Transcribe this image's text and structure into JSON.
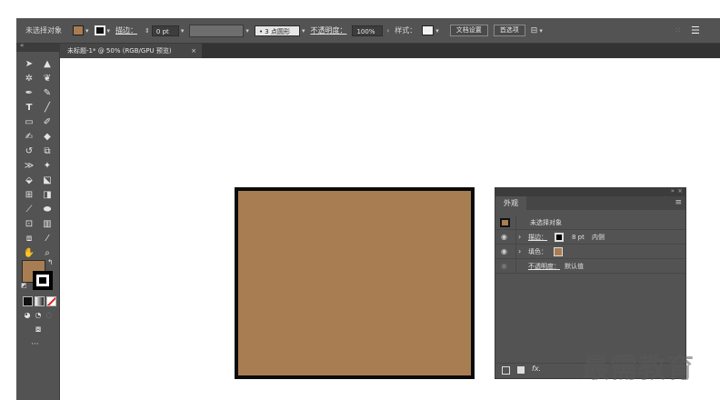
{
  "control_bar": {
    "selection_label": "未选择对象",
    "stroke_label": "描边：",
    "stroke_weight": "0 pt",
    "brush_preset": "3 点圆形",
    "opacity_label": "不透明度：",
    "opacity_value": "100%",
    "style_label": "样式：",
    "doc_setup_button": "文档设置",
    "preferences_button": "首选项"
  },
  "document_tab": {
    "title": "未标题-1* @ 50% (RGB/GPU 预览)",
    "close": "×"
  },
  "appearance_panel": {
    "tab": "外观",
    "object_label": "未选择对象",
    "stroke_label": "描边：",
    "stroke_weight": "8 pt",
    "stroke_align": "内侧",
    "fill_label": "填色：",
    "opacity_label": "不透明度：",
    "opacity_value": "默认值",
    "fx_label": "fx."
  },
  "colors": {
    "fill": "#a87d52",
    "stroke": "#0b0b0b"
  },
  "toolbar": {
    "more_tools": "···"
  },
  "watermark": "最需教育"
}
